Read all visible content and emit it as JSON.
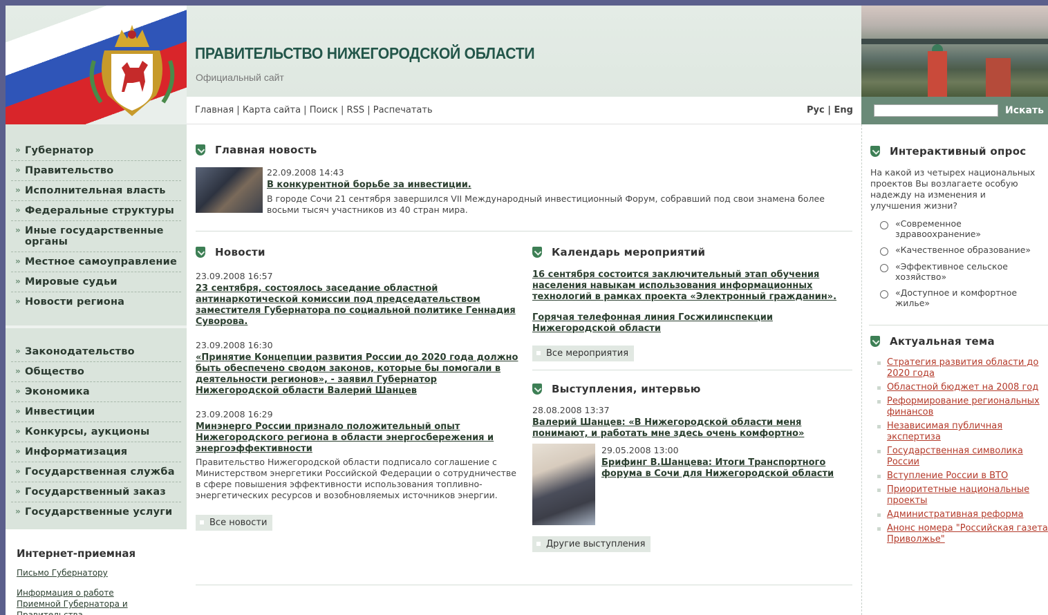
{
  "header": {
    "title": "ПРАВИТЕЛЬСТВО НИЖЕГОРОДСКОЙ ОБЛАСТИ",
    "subtitle": "Официальный сайт"
  },
  "topnav": {
    "links": [
      "Главная",
      "Карта сайта",
      "Поиск",
      "RSS",
      "Распечатать"
    ],
    "lang_ru": "Рус",
    "lang_en": "Eng"
  },
  "search": {
    "placeholder": "",
    "button": "Искать"
  },
  "sidebar": {
    "menu1": [
      "Губернатор",
      "Правительство",
      "Исполнительная власть",
      "Федеральные структуры",
      "Иные государственные органы",
      "Местное самоуправление",
      "Мировые судьи",
      "Новости региона"
    ],
    "menu2": [
      "Законодательство",
      "Общество",
      "Экономика",
      "Инвестиции",
      "Конкурсы, аукционы",
      "Информатизация",
      "Государственная служба",
      "Государственный заказ",
      "Государственные услуги"
    ],
    "reception_title": "Интернет-приемная",
    "reception_link1": "Письмо Губернатору",
    "reception_link2": "Информация о работе Приемной Губернатора и Правительства"
  },
  "main_news": {
    "heading": "Главная новость",
    "date": "22.09.2008 14:43",
    "title": "В конкурентной борьбе за инвестиции.",
    "text": "В городе Сочи 21 сентября завершился VII Международный инвестиционный Форум, собравший под свои знамена более восьми тысяч участников из 40 стран мира."
  },
  "news": {
    "heading": "Новости",
    "items": [
      {
        "date": "23.09.2008 16:57",
        "title": "23 сентября, состоялось заседание областной антинаркотической комиссии под председательством заместителя Губернатора по социальной политике Геннадия Суворова.",
        "text": ""
      },
      {
        "date": "23.09.2008 16:30",
        "title": "«Принятие Концепции развития России до 2020 года должно быть обеспечено сводом законов, которые бы помогали в деятельности регионов», - заявил Губернатор Нижегородской области Валерий Шанцев",
        "text": ""
      },
      {
        "date": "23.09.2008 16:29",
        "title": "Минэнерго России признало положительный опыт Нижегородского региона в области энергосбережения и энергоэффективности",
        "text": "Правительство Нижегородской области подписало соглашение с Министерством энергетики Российской Федерации о сотрудничестве в сфере повышения эффективности использования топливно-энергетических ресурсов и возобновляемых источников энергии."
      }
    ],
    "all_button": "Все новости"
  },
  "calendar": {
    "heading": "Календарь мероприятий",
    "items": [
      "16 сентября состоится заключительный этап обучения населения навыкам использования информационных технологий в рамках проекта «Электронный гражданин».",
      "Горячая телефонная линия Госжилинспекции Нижегородской области"
    ],
    "all_button": "Все мероприятия"
  },
  "speeches": {
    "heading": "Выступления, интервью",
    "item1_date": "28.08.2008 13:37",
    "item1_title": "Валерий Шанцев: «В Нижегородской области меня понимают, и работать мне здесь очень комфортно»",
    "item2_date": "29.05.2008 13:00",
    "item2_title": "Брифинг В.Шанцева: Итоги Транспортного форума в Сочи для Нижегородской области",
    "other_button": "Другие выступления"
  },
  "poll": {
    "heading": "Интерактивный опрос",
    "question": "На какой из четырех национальных проектов Вы возлагаете особую надежду на изменения и улучшения жизни?",
    "options": [
      "«Современное здравоохранение»",
      "«Качественное образование»",
      "«Эффективное сельское хозяйство»",
      "«Доступное и комфортное жилье»"
    ]
  },
  "topics": {
    "heading": "Актуальная тема",
    "items": [
      "Стратегия развития области до 2020 года",
      "Областной бюджет на 2008 год",
      "Реформирование региональных финансов",
      "Независимая публичная экспертиза",
      "Государственная символика России",
      "Вступление России в ВТО",
      "Приоритетные национальные проекты",
      "Административная реформа",
      "Анонс номера \"Российская газета Приволжье\""
    ]
  },
  "colors": {
    "accent": "#3d7f55",
    "sidebar_bg": "#dae4dc",
    "link_red": "#b43a2a",
    "search_bar": "#6a8a78"
  }
}
